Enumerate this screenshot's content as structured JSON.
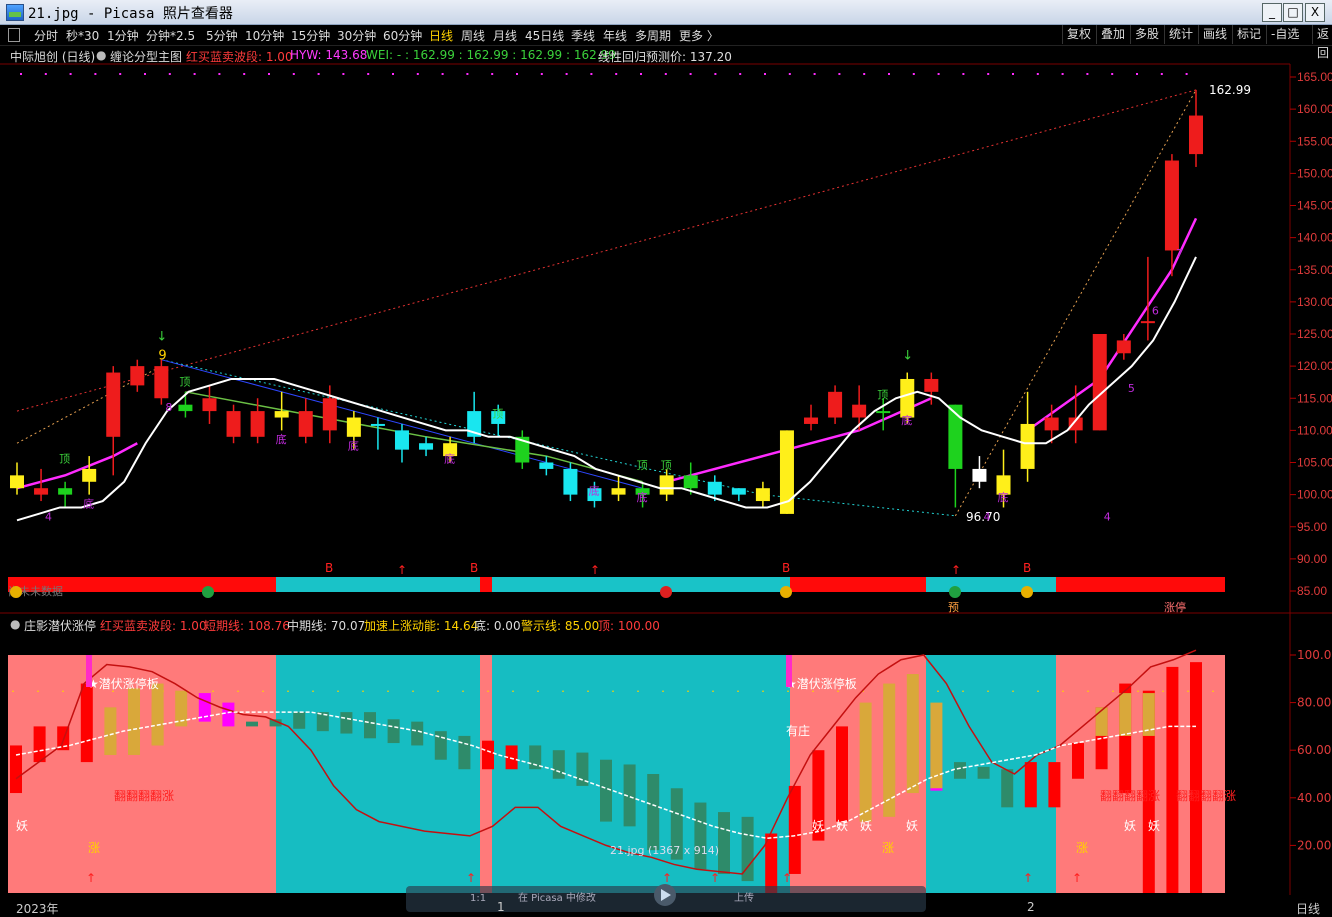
{
  "window": {
    "title": "21.jpg - Picasa 照片查看器",
    "min": "_",
    "max": "□",
    "close": "X"
  },
  "toolbar": {
    "items": [
      "分时",
      "秒*30",
      "1分钟",
      "分钟*2.5",
      "5分钟",
      "10分钟",
      "15分钟",
      "30分钟",
      "60分钟",
      "日线",
      "周线",
      "月线",
      "45日线",
      "季线",
      "年线",
      "多周期",
      "更多 〉"
    ],
    "active": "日线",
    "right": [
      "复权",
      "叠加",
      "多股",
      "统计",
      "画线",
      "标记",
      "-自选",
      "返回"
    ]
  },
  "main_header": {
    "stock": "中际旭创 (日线)",
    "indicator": "缠论分型主图",
    "i1": "红买蓝卖波段: 1.00",
    "i2": "HYW: 143.68",
    "i3": "WEI: - : 162.99 : 162.99 : 162.99 : 162.99",
    "i4": "线性回归预测价: 137.20"
  },
  "sub_header": {
    "name": "庄影潜伏涨停",
    "i1": "红买蓝卖波段: 1.00",
    "i2": "短期线: 108.76",
    "i3": "中期线: 70.07",
    "i4": "加速上涨动能: 14.64",
    "i5": "底: 0.00",
    "i6": "警示线: 85.00",
    "i7": "顶: 100.00"
  },
  "price_axis": [
    "165.00",
    "160.00",
    "155.00",
    "150.00",
    "145.00",
    "140.00",
    "135.00",
    "130.00",
    "125.00",
    "120.00",
    "115.00",
    "110.00",
    "105.00",
    "100.00",
    "95.00",
    "90.00",
    "85.00"
  ],
  "sub_axis": [
    "100.00",
    "80.00",
    "60.00",
    "40.00",
    "20.00"
  ],
  "annotations": {
    "high": "162.99",
    "low": "96.70",
    "wave": [
      "1",
      "4",
      "8",
      "9",
      "7",
      "6",
      "5",
      "4",
      "3",
      "2",
      "1"
    ],
    "ding": "顶",
    "di": "底",
    "b": "B",
    "yu": "预",
    "zhangting": "涨停",
    "qianfu": "★潜伏涨停板",
    "youzhuang": "有庄",
    "yao": "妖",
    "zhang": "涨",
    "cisi": "翻翻翻翻涨",
    "weiwei": "尚未未数据"
  },
  "bottom": {
    "year": "2023年",
    "m1": "1",
    "m2": "2",
    "period": "日线"
  },
  "picasa_overlay": {
    "label": "21.jpg (1367 x 914)",
    "edit": "在 Picasa 中修改",
    "upload": "上传",
    "ratio": "1:1"
  },
  "chart_data": {
    "type": "candlestick",
    "title": "中际旭创 (日线)",
    "ylim": [
      85,
      165
    ],
    "candles": [
      {
        "o": 101,
        "c": 103,
        "h": 105,
        "l": 100,
        "color": "yellow"
      },
      {
        "o": 101,
        "c": 100,
        "h": 104,
        "l": 99,
        "color": "red"
      },
      {
        "o": 100,
        "c": 101,
        "h": 102,
        "l": 98,
        "color": "green"
      },
      {
        "o": 102,
        "c": 104,
        "h": 106,
        "l": 100,
        "color": "yellow"
      },
      {
        "o": 119,
        "c": 109,
        "h": 120,
        "l": 103,
        "color": "red"
      },
      {
        "o": 120,
        "c": 117,
        "h": 121,
        "l": 116,
        "color": "red"
      },
      {
        "o": 120,
        "c": 115,
        "h": 121,
        "l": 114,
        "color": "red"
      },
      {
        "o": 114,
        "c": 113,
        "h": 116,
        "l": 112,
        "color": "green"
      },
      {
        "o": 115,
        "c": 113,
        "h": 117,
        "l": 111,
        "color": "red"
      },
      {
        "o": 113,
        "c": 109,
        "h": 114,
        "l": 108,
        "color": "red"
      },
      {
        "o": 113,
        "c": 109,
        "h": 115,
        "l": 108,
        "color": "red"
      },
      {
        "o": 113,
        "c": 112,
        "h": 116,
        "l": 110,
        "color": "yellow"
      },
      {
        "o": 113,
        "c": 109,
        "h": 115,
        "l": 108,
        "color": "red"
      },
      {
        "o": 115,
        "c": 110,
        "h": 117,
        "l": 108,
        "color": "red"
      },
      {
        "o": 109,
        "c": 112,
        "h": 113,
        "l": 107,
        "color": "yellow"
      },
      {
        "o": 111,
        "c": 111,
        "h": 112,
        "l": 107,
        "color": "cyan"
      },
      {
        "o": 107,
        "c": 110,
        "h": 111,
        "l": 105,
        "color": "cyan"
      },
      {
        "o": 108,
        "c": 107,
        "h": 109,
        "l": 106,
        "color": "cyan"
      },
      {
        "o": 106,
        "c": 108,
        "h": 109,
        "l": 105,
        "color": "yellow"
      },
      {
        "o": 109,
        "c": 113,
        "h": 116,
        "l": 108,
        "color": "cyan"
      },
      {
        "o": 111,
        "c": 113,
        "h": 114,
        "l": 109,
        "color": "cyan"
      },
      {
        "o": 105,
        "c": 109,
        "h": 110,
        "l": 104,
        "color": "green"
      },
      {
        "o": 105,
        "c": 104,
        "h": 106,
        "l": 103,
        "color": "cyan"
      },
      {
        "o": 100,
        "c": 104,
        "h": 105,
        "l": 99,
        "color": "cyan"
      },
      {
        "o": 99,
        "c": 101,
        "h": 102,
        "l": 98,
        "color": "cyan"
      },
      {
        "o": 100,
        "c": 101,
        "h": 103,
        "l": 99,
        "color": "yellow"
      },
      {
        "o": 101,
        "c": 100,
        "h": 102,
        "l": 98,
        "color": "green"
      },
      {
        "o": 100,
        "c": 103,
        "h": 104,
        "l": 99,
        "color": "yellow"
      },
      {
        "o": 101,
        "c": 103,
        "h": 105,
        "l": 100,
        "color": "green"
      },
      {
        "o": 100,
        "c": 102,
        "h": 103,
        "l": 99,
        "color": "cyan"
      },
      {
        "o": 100,
        "c": 101,
        "h": 101,
        "l": 99,
        "color": "cyan"
      },
      {
        "o": 99,
        "c": 101,
        "h": 102,
        "l": 98,
        "color": "yellow"
      },
      {
        "o": 97,
        "c": 110,
        "h": 110,
        "l": 97,
        "color": "yellow"
      },
      {
        "o": 112,
        "c": 111,
        "h": 114,
        "l": 110,
        "color": "red"
      },
      {
        "o": 116,
        "c": 112,
        "h": 117,
        "l": 111,
        "color": "red"
      },
      {
        "o": 114,
        "c": 112,
        "h": 117,
        "l": 110,
        "color": "red"
      },
      {
        "o": 113,
        "c": 113,
        "h": 115,
        "l": 110,
        "color": "green"
      },
      {
        "o": 118,
        "c": 112,
        "h": 119,
        "l": 111,
        "color": "yellow"
      },
      {
        "o": 118,
        "c": 116,
        "h": 119,
        "l": 114,
        "color": "red"
      },
      {
        "o": 104,
        "c": 114,
        "h": 114,
        "l": 98,
        "color": "green"
      },
      {
        "o": 102,
        "c": 104,
        "h": 106,
        "l": 101,
        "color": "white"
      },
      {
        "o": 103,
        "c": 100,
        "h": 107,
        "l": 98,
        "color": "yellow"
      },
      {
        "o": 104,
        "c": 111,
        "h": 116,
        "l": 102,
        "color": "yellow"
      },
      {
        "o": 110,
        "c": 112,
        "h": 114,
        "l": 108,
        "color": "red"
      },
      {
        "o": 110,
        "c": 112,
        "h": 117,
        "l": 108,
        "color": "red"
      },
      {
        "o": 110,
        "c": 125,
        "h": 125,
        "l": 110,
        "color": "red"
      },
      {
        "o": 124,
        "c": 122,
        "h": 125,
        "l": 121,
        "color": "red"
      },
      {
        "o": 127,
        "c": 127,
        "h": 137,
        "l": 124,
        "color": "red"
      },
      {
        "o": 138,
        "c": 152,
        "h": 153,
        "l": 134,
        "color": "red"
      },
      {
        "o": 153,
        "c": 159,
        "h": 163,
        "l": 151,
        "color": "red"
      }
    ],
    "ma_white": [
      96,
      97,
      98,
      98,
      99,
      102,
      108,
      113,
      116,
      117,
      118,
      118,
      118,
      117,
      116,
      115,
      114,
      113,
      112,
      111,
      110,
      110,
      109,
      109,
      108,
      107,
      106,
      104,
      103,
      102,
      101,
      101,
      100,
      99,
      98,
      98,
      99,
      102,
      106,
      110,
      113,
      115,
      116,
      115,
      112,
      110,
      109,
      108,
      108,
      110,
      114,
      117,
      120,
      124,
      130,
      137
    ],
    "ma_magenta": [
      101,
      102,
      103,
      104,
      105,
      106,
      110,
      113,
      115,
      117,
      118,
      119,
      120,
      122,
      126,
      130,
      135,
      143
    ]
  }
}
